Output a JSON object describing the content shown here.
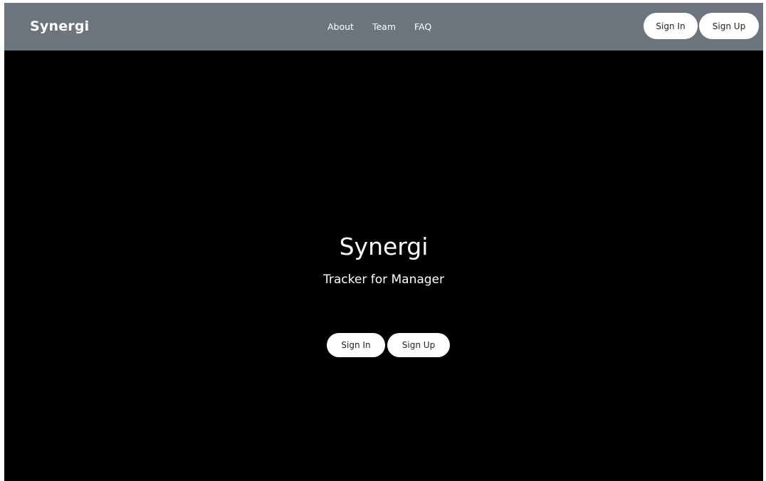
{
  "navbar": {
    "brand": "Synergi",
    "links": [
      {
        "label": "About"
      },
      {
        "label": "Team"
      },
      {
        "label": "FAQ"
      }
    ],
    "signin_label": "Sign In",
    "signup_label": "Sign Up"
  },
  "hero": {
    "title": "Synergi",
    "subtitle": "Tracker for Manager",
    "signin_label": "Sign In",
    "signup_label": "Sign Up"
  },
  "colors": {
    "navbar_bg": "#6c757d",
    "page_bg": "#000000",
    "button_bg": "#ffffff",
    "text_light": "#ffffff"
  }
}
